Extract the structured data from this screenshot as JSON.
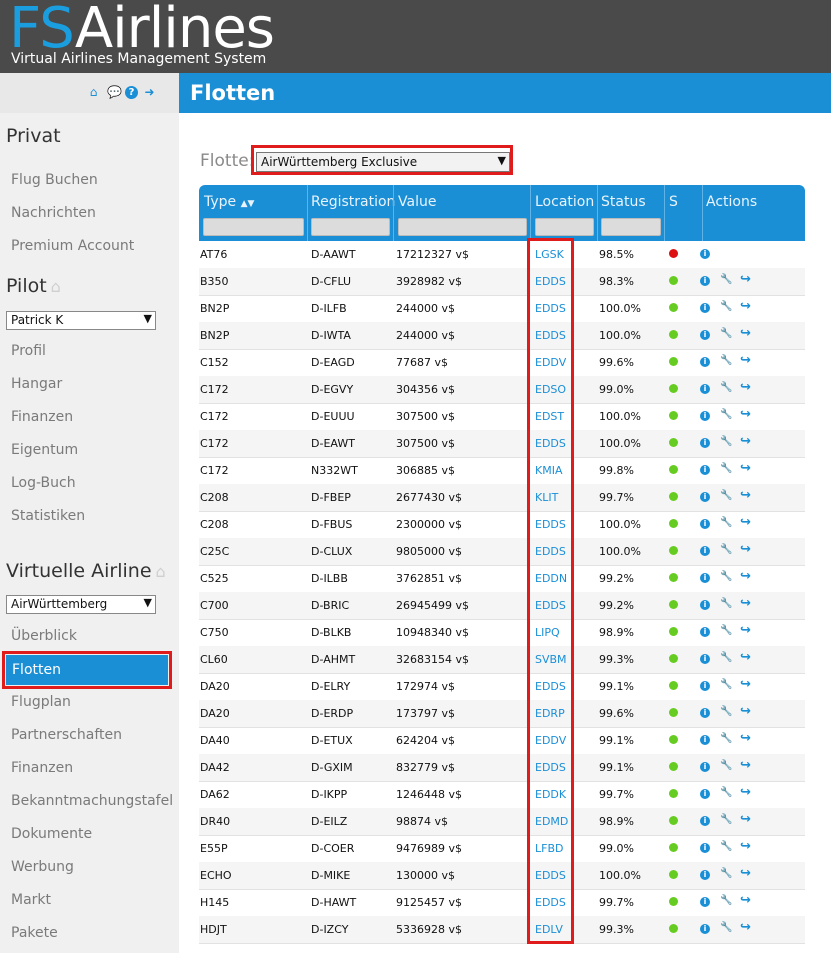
{
  "header": {
    "logo_fs": "FS",
    "logo_rest": "Airlines",
    "tagline": "Virtual Airlines Management System"
  },
  "sidebar": {
    "icons": [
      "home-icon",
      "chat-icon",
      "help-icon",
      "logout-icon"
    ],
    "privat": {
      "title": "Privat",
      "items": [
        "Flug Buchen",
        "Nachrichten",
        "Premium Account"
      ]
    },
    "pilot": {
      "title": "Pilot",
      "selected": "Patrick K",
      "items": [
        "Profil",
        "Hangar",
        "Finanzen",
        "Eigentum",
        "Log-Buch",
        "Statistiken"
      ]
    },
    "airline": {
      "title": "Virtuelle Airline",
      "selected": "AirWürttemberg",
      "items_before": [
        "Überblick"
      ],
      "active": "Flotten",
      "items_after": [
        "Flugplan",
        "Partnerschaften",
        "Finanzen",
        "Bekanntmachungstafel",
        "Dokumente",
        "Werbung",
        "Markt",
        "Pakete"
      ]
    }
  },
  "page": {
    "title": "Flotten",
    "fleet_label": "Flotte:",
    "fleet_selected": "AirWürttemberg Exclusive"
  },
  "table": {
    "headers": {
      "type": "Type",
      "registration": "Registration",
      "value": "Value",
      "location": "Location",
      "status": "Status",
      "s": "S",
      "actions": "Actions"
    },
    "status_colors": {
      "ok": "#66cc22",
      "bad": "#dd1111"
    },
    "rows": [
      {
        "type": "AT76",
        "reg": "D-AAWT",
        "value": "17212327 v$",
        "loc": "LGSK",
        "status": "98.5%",
        "s": "bad",
        "full": false
      },
      {
        "type": "B350",
        "reg": "D-CFLU",
        "value": "3928982 v$",
        "loc": "EDDS",
        "status": "98.3%",
        "s": "ok",
        "full": true
      },
      {
        "type": "BN2P",
        "reg": "D-ILFB",
        "value": "244000 v$",
        "loc": "EDDS",
        "status": "100.0%",
        "s": "ok",
        "full": true
      },
      {
        "type": "BN2P",
        "reg": "D-IWTA",
        "value": "244000 v$",
        "loc": "EDDS",
        "status": "100.0%",
        "s": "ok",
        "full": true
      },
      {
        "type": "C152",
        "reg": "D-EAGD",
        "value": "77687 v$",
        "loc": "EDDV",
        "status": "99.6%",
        "s": "ok",
        "full": true
      },
      {
        "type": "C172",
        "reg": "D-EGVY",
        "value": "304356 v$",
        "loc": "EDSO",
        "status": "99.0%",
        "s": "ok",
        "full": true
      },
      {
        "type": "C172",
        "reg": "D-EUUU",
        "value": "307500 v$",
        "loc": "EDST",
        "status": "100.0%",
        "s": "ok",
        "full": true
      },
      {
        "type": "C172",
        "reg": "D-EAWT",
        "value": "307500 v$",
        "loc": "EDDS",
        "status": "100.0%",
        "s": "ok",
        "full": true
      },
      {
        "type": "C172",
        "reg": "N332WT",
        "value": "306885 v$",
        "loc": "KMIA",
        "status": "99.8%",
        "s": "ok",
        "full": true
      },
      {
        "type": "C208",
        "reg": "D-FBEP",
        "value": "2677430 v$",
        "loc": "KLIT",
        "status": "99.7%",
        "s": "ok",
        "full": true
      },
      {
        "type": "C208",
        "reg": "D-FBUS",
        "value": "2300000 v$",
        "loc": "EDDS",
        "status": "100.0%",
        "s": "ok",
        "full": true
      },
      {
        "type": "C25C",
        "reg": "D-CLUX",
        "value": "9805000 v$",
        "loc": "EDDS",
        "status": "100.0%",
        "s": "ok",
        "full": true
      },
      {
        "type": "C525",
        "reg": "D-ILBB",
        "value": "3762851 v$",
        "loc": "EDDN",
        "status": "99.2%",
        "s": "ok",
        "full": true
      },
      {
        "type": "C700",
        "reg": "D-BRIC",
        "value": "26945499 v$",
        "loc": "EDDS",
        "status": "99.2%",
        "s": "ok",
        "full": true
      },
      {
        "type": "C750",
        "reg": "D-BLKB",
        "value": "10948340 v$",
        "loc": "LIPQ",
        "status": "98.9%",
        "s": "ok",
        "full": true
      },
      {
        "type": "CL60",
        "reg": "D-AHMT",
        "value": "32683154 v$",
        "loc": "SVBM",
        "status": "99.3%",
        "s": "ok",
        "full": true
      },
      {
        "type": "DA20",
        "reg": "D-ELRY",
        "value": "172974 v$",
        "loc": "EDDS",
        "status": "99.1%",
        "s": "ok",
        "full": true
      },
      {
        "type": "DA20",
        "reg": "D-ERDP",
        "value": "173797 v$",
        "loc": "EDRP",
        "status": "99.6%",
        "s": "ok",
        "full": true
      },
      {
        "type": "DA40",
        "reg": "D-ETUX",
        "value": "624204 v$",
        "loc": "EDDV",
        "status": "99.1%",
        "s": "ok",
        "full": true
      },
      {
        "type": "DA42",
        "reg": "D-GXIM",
        "value": "832779 v$",
        "loc": "EDDS",
        "status": "99.1%",
        "s": "ok",
        "full": true
      },
      {
        "type": "DA62",
        "reg": "D-IKPP",
        "value": "1246448 v$",
        "loc": "EDDK",
        "status": "99.7%",
        "s": "ok",
        "full": true
      },
      {
        "type": "DR40",
        "reg": "D-EILZ",
        "value": "98874 v$",
        "loc": "EDMD",
        "status": "98.9%",
        "s": "ok",
        "full": true
      },
      {
        "type": "E55P",
        "reg": "D-COER",
        "value": "9476989 v$",
        "loc": "LFBD",
        "status": "99.0%",
        "s": "ok",
        "full": true
      },
      {
        "type": "ECHO",
        "reg": "D-MIKE",
        "value": "130000 v$",
        "loc": "EDDS",
        "status": "100.0%",
        "s": "ok",
        "full": true
      },
      {
        "type": "H145",
        "reg": "D-HAWT",
        "value": "9125457 v$",
        "loc": "EDDS",
        "status": "99.7%",
        "s": "ok",
        "full": true
      },
      {
        "type": "HDJT",
        "reg": "D-IZCY",
        "value": "5336928 v$",
        "loc": "EDLV",
        "status": "99.3%",
        "s": "ok",
        "full": true
      }
    ]
  }
}
